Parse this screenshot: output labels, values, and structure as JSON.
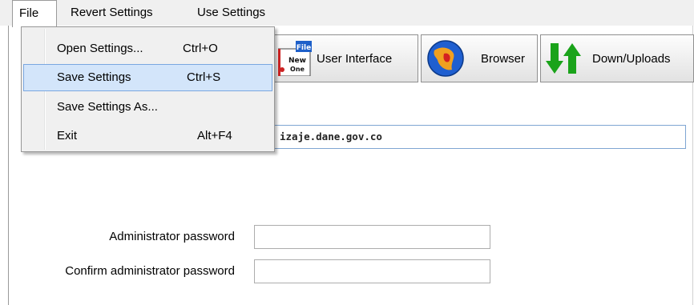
{
  "menubar": {
    "file": "File",
    "revert": "Revert Settings",
    "use": "Use Settings"
  },
  "file_menu": [
    {
      "label": "Open Settings...",
      "shortcut": "Ctrl+O"
    },
    {
      "label": "Save Settings",
      "shortcut": "Ctrl+S"
    },
    {
      "label": "Save Settings As...",
      "shortcut": ""
    },
    {
      "label": "Exit",
      "shortcut": "Alt+F4"
    }
  ],
  "toolbar": {
    "user_interface": "User Interface",
    "browser": "Browser",
    "downloads": "Down/Uploads",
    "file_icon_text": "File",
    "new_icon_text": "New",
    "one_icon_text": "One"
  },
  "form": {
    "url_value": "izaje.dane.gov.co",
    "admin_password_label": "Administrator password",
    "confirm_password_label": "Confirm administrator password"
  },
  "colors": {
    "highlight_bg": "#d3e5fa",
    "highlight_border": "#7aa7e0",
    "arrow_green": "#1aa31a"
  }
}
